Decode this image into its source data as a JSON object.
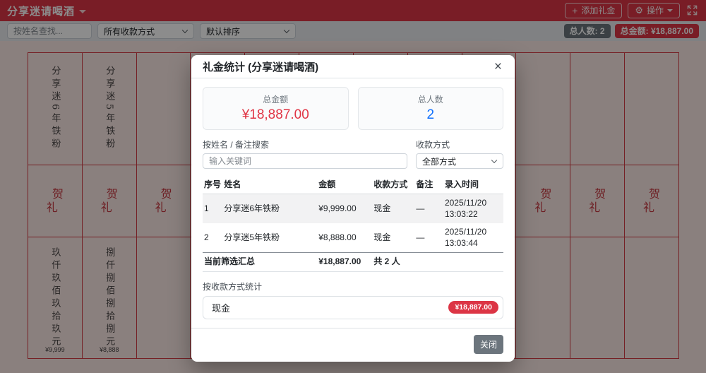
{
  "colors": {
    "accent_red": "#dc3545",
    "value_blue": "#0d6efd",
    "ledger_border": "#d63b44",
    "secondary_gray": "#6c757d"
  },
  "header": {
    "title": "分享迷请喝酒",
    "add_gift_button": "添加礼金",
    "actions_button": "操作"
  },
  "filter_bar": {
    "search_placeholder": "按姓名查找...",
    "payment_filter_value": "所有收款方式",
    "sort_value": "默认排序",
    "total_people_badge": "总人数: 2",
    "total_amount_badge": "总金额: ¥18,887.00"
  },
  "ledger": {
    "greeting": "贺礼",
    "columns": [
      {
        "name": "分享迷6年铁粉",
        "amount_cn": "玖仟玖佰玖拾玖元",
        "amount": "¥9,999"
      },
      {
        "name": "分享迷5年铁粉",
        "amount_cn": "捌仟捌佰捌拾捌元",
        "amount": "¥8,888"
      },
      {
        "name": "",
        "amount_cn": "",
        "amount": ""
      },
      {
        "name": "",
        "amount_cn": "",
        "amount": ""
      },
      {
        "name": "",
        "amount_cn": "",
        "amount": ""
      },
      {
        "name": "",
        "amount_cn": "",
        "amount": ""
      },
      {
        "name": "",
        "amount_cn": "",
        "amount": ""
      },
      {
        "name": "",
        "amount_cn": "",
        "amount": ""
      },
      {
        "name": "",
        "amount_cn": "",
        "amount": ""
      },
      {
        "name": "",
        "amount_cn": "",
        "amount": ""
      },
      {
        "name": "",
        "amount_cn": "",
        "amount": ""
      },
      {
        "name": "",
        "amount_cn": "",
        "amount": ""
      }
    ]
  },
  "modal": {
    "title": "礼金统计 (分享迷请喝酒)",
    "close_icon": "×",
    "stats": {
      "amount_label": "总金额",
      "amount_value": "¥18,887.00",
      "people_label": "总人数",
      "people_value": "2"
    },
    "search_label": "按姓名 / 备注搜索",
    "search_placeholder": "输入关键词",
    "payment_label": "收款方式",
    "payment_value": "全部方式",
    "table": {
      "headers": [
        "序号",
        "姓名",
        "金额",
        "收款方式",
        "备注",
        "录入时间"
      ],
      "rows": [
        [
          "1",
          "分享迷6年铁粉",
          "¥9,999.00",
          "现金",
          "—",
          "2025/11/20 13:03:22"
        ],
        [
          "2",
          "分享迷5年铁粉",
          "¥8,888.00",
          "现金",
          "—",
          "2025/11/20 13:03:44"
        ]
      ],
      "summary": {
        "label": "当前筛选汇总",
        "amount": "¥18,887.00",
        "count": "共 2 人"
      }
    },
    "method_stats_label": "按收款方式统计",
    "method_stats": [
      {
        "method": "现金",
        "amount": "¥18,887.00"
      }
    ],
    "close_button": "关闭"
  }
}
